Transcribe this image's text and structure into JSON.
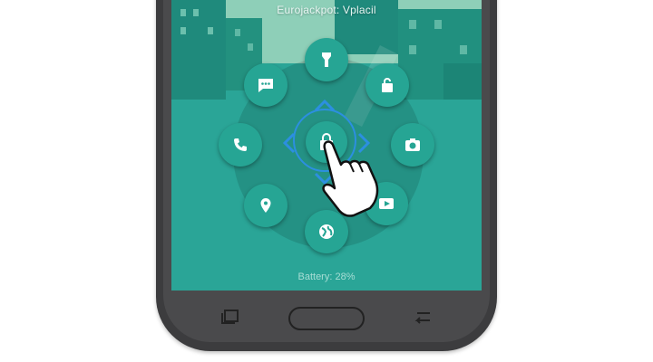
{
  "status": {
    "carrier_text": "Eurojackpot: Vplacil",
    "battery_text": "Battery: 28%"
  },
  "launcher": {
    "center": {
      "icon": "lock-icon"
    },
    "shortcuts": [
      {
        "name": "flashlight",
        "icon": "flashlight-icon"
      },
      {
        "name": "unlock",
        "icon": "unlock-icon"
      },
      {
        "name": "camera",
        "icon": "camera-icon"
      },
      {
        "name": "youtube",
        "icon": "play-icon"
      },
      {
        "name": "browser",
        "icon": "globe-icon"
      },
      {
        "name": "maps",
        "icon": "map-pin-icon"
      },
      {
        "name": "phone",
        "icon": "phone-icon"
      },
      {
        "name": "messages",
        "icon": "message-icon"
      }
    ]
  },
  "navbar": {
    "buttons": [
      "recent-apps",
      "home",
      "back"
    ]
  },
  "colors": {
    "screen": "#2aa597",
    "shortcut": "#26a594",
    "arrow_accent": "#2c8fe0",
    "phone_body": "#3c3c3e"
  }
}
